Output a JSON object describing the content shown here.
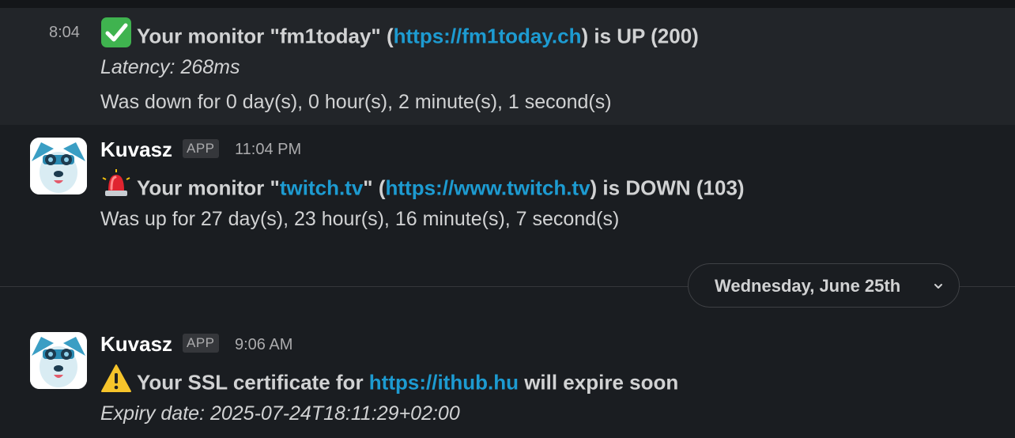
{
  "msg1": {
    "time": "8:04",
    "status_emoji": "check-mark-button-icon",
    "title_prefix": "Your monitor \"fm1today\" (",
    "title_link": "https://fm1today.ch",
    "title_suffix": ") is UP (200)",
    "latency": "Latency: 268ms",
    "detail": "Was down for 0 day(s), 0 hour(s), 2 minute(s), 1 second(s)"
  },
  "msg2": {
    "sender": "Kuvasz",
    "badge": "APP",
    "time": "11:04 PM",
    "status_emoji": "police-light-icon",
    "title_prefix": "Your monitor \"",
    "title_name_link": "twitch.tv",
    "title_mid": "\" (",
    "title_link": "https://www.twitch.tv",
    "title_suffix": ") is DOWN (103)",
    "detail": "Was up for 27 day(s), 23 hour(s), 16 minute(s), 7 second(s)"
  },
  "date_divider": {
    "label": "Wednesday, June 25th"
  },
  "msg3": {
    "sender": "Kuvasz",
    "badge": "APP",
    "time": "9:06 AM",
    "status_emoji": "warning-icon",
    "title_prefix": "Your SSL certificate for ",
    "title_link": "https://ithub.hu",
    "title_suffix": " will expire soon",
    "expiry": "Expiry date: 2025-07-24T18:11:29+02:00"
  },
  "colors": {
    "background": "#1a1d21",
    "hover_background": "#222529",
    "link": "#1d9bd1",
    "text": "#d1d2d3",
    "muted": "#ababad"
  }
}
